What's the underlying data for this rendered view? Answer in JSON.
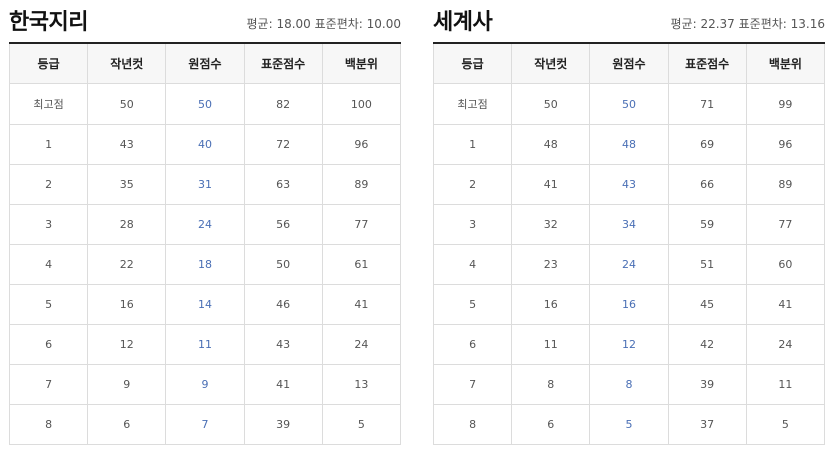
{
  "columns": [
    "등급",
    "작년컷",
    "원점수",
    "표준점수",
    "백분위"
  ],
  "tables": [
    {
      "title": "한국지리",
      "stats": "평균: 18.00 표준편차: 10.00",
      "rows": [
        [
          "최고점",
          "50",
          "50",
          "82",
          "100"
        ],
        [
          "1",
          "43",
          "40",
          "72",
          "96"
        ],
        [
          "2",
          "35",
          "31",
          "63",
          "89"
        ],
        [
          "3",
          "28",
          "24",
          "56",
          "77"
        ],
        [
          "4",
          "22",
          "18",
          "50",
          "61"
        ],
        [
          "5",
          "16",
          "14",
          "46",
          "41"
        ],
        [
          "6",
          "12",
          "11",
          "43",
          "24"
        ],
        [
          "7",
          "9",
          "9",
          "41",
          "13"
        ],
        [
          "8",
          "6",
          "7",
          "39",
          "5"
        ]
      ]
    },
    {
      "title": "세계사",
      "stats": "평균: 22.37 표준편차: 13.16",
      "rows": [
        [
          "최고점",
          "50",
          "50",
          "71",
          "99"
        ],
        [
          "1",
          "48",
          "48",
          "69",
          "96"
        ],
        [
          "2",
          "41",
          "43",
          "66",
          "89"
        ],
        [
          "3",
          "32",
          "34",
          "59",
          "77"
        ],
        [
          "4",
          "23",
          "24",
          "51",
          "60"
        ],
        [
          "5",
          "16",
          "16",
          "45",
          "41"
        ],
        [
          "6",
          "11",
          "12",
          "42",
          "24"
        ],
        [
          "7",
          "8",
          "8",
          "39",
          "11"
        ],
        [
          "8",
          "6",
          "5",
          "37",
          "5"
        ]
      ]
    }
  ],
  "colors": {
    "raw_score_text": "#4a6fb5",
    "header_bg": "#f7f7f7",
    "border": "#dcdcdc",
    "title_rule": "#222222"
  }
}
